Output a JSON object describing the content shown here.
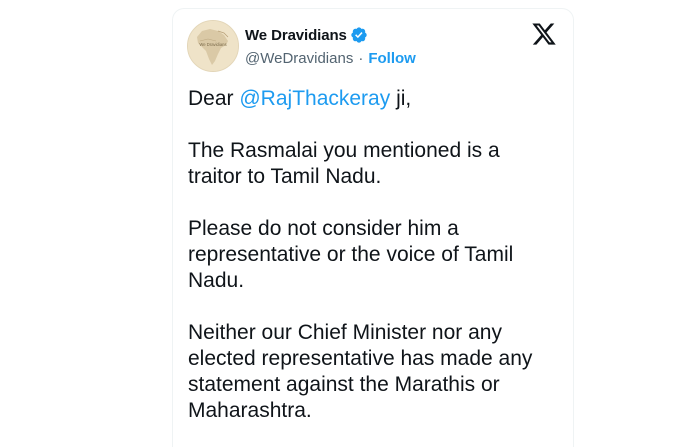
{
  "author": {
    "display_name": "We Dravidians",
    "handle": "@WeDravidians",
    "separator": "·",
    "follow_label": "Follow",
    "verified": true,
    "avatar_text": "We Dravidians"
  },
  "brand": {
    "logo_icon": "x-logo-icon"
  },
  "tweet": {
    "greeting_prefix": "Dear ",
    "mention": "@RajThackeray",
    "greeting_suffix": " ji,",
    "paragraph_2": "The Rasmalai you mentioned is a\ntraitor to Tamil Nadu.",
    "paragraph_3": "Please do not consider him a\nrepresentative or the voice of Tamil\nNadu.",
    "paragraph_4": "Neither our Chief Minister nor any\nelected representative has made any\nstatement against the Marathis or\nMaharashtra."
  },
  "colors": {
    "link_blue": "#1d9bf0",
    "text_primary": "#0f1419",
    "text_secondary": "#536471"
  }
}
